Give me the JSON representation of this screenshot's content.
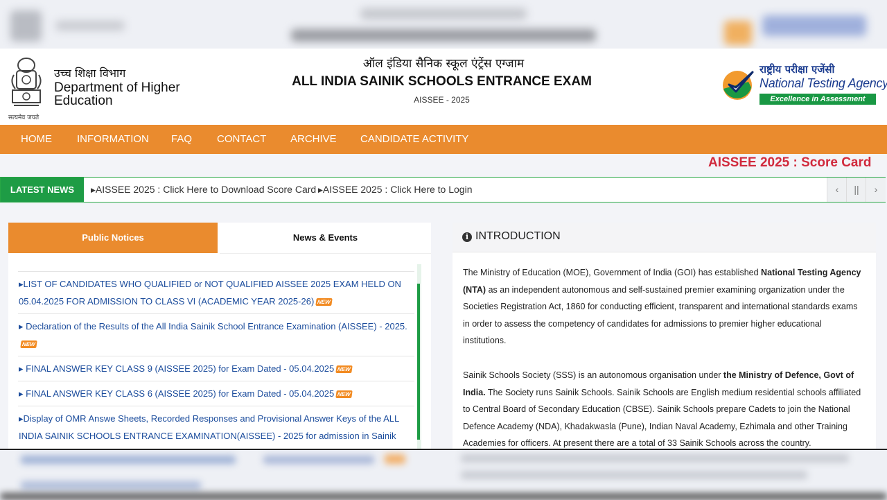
{
  "header": {
    "dept_hindi": "उच्च शिक्षा विभाग",
    "dept_english": "Department of Higher Education",
    "emblem_caption": "सत्यमेव जयते",
    "title_hindi": "ऑल इंडिया सैनिक स्कूल एंट्रेंस एग्जाम",
    "title_english": "ALL INDIA SAINIK SCHOOLS ENTRANCE EXAM",
    "subtitle": "AISSEE - 2025",
    "nta_hindi": "राष्ट्रीय परीक्षा एजेंसी",
    "nta_english": "National Testing Agency",
    "nta_tagline": "Excellence in Assessment"
  },
  "nav": {
    "items": [
      "HOME",
      "INFORMATION",
      "FAQ",
      "CONTACT",
      "ARCHIVE",
      "CANDIDATE ACTIVITY"
    ]
  },
  "marquee": "AISSEE 2025 : Score Card",
  "latest_news": {
    "label": "LATEST NEWS",
    "items": [
      "AISSEE 2025 : Click Here to Download Score Card",
      "AISSEE 2025 : Click Here to Login"
    ],
    "controls": [
      "‹",
      "||",
      "›"
    ]
  },
  "tabs": {
    "public_notices": "Public Notices",
    "news_events": "News & Events"
  },
  "notices": [
    {
      "text": "LIST OF CANDIDATES WHO QUALIFIED or NOT QUALIFIED AISSEE 2025 EXAM HELD ON 05.04.2025 FOR ADMISSION TO CLASS VI (ACADEMIC YEAR 2025-26)",
      "new": "NEW"
    },
    {
      "text": " Declaration of the Results of the All India Sainik School Entrance Examination (AISSEE) - 2025.",
      "new": "NEW"
    },
    {
      "text": " FINAL ANSWER KEY CLASS 9 (AISSEE 2025) for Exam Dated - 05.04.2025",
      "new": "NEW"
    },
    {
      "text": " FINAL ANSWER KEY CLASS 6 (AISSEE 2025) for Exam Dated - 05.04.2025",
      "new": "NEW"
    },
    {
      "text": "Display of OMR Answe Sheets, Recorded Responses and Provisional Answer Keys of the ALL INDIA SAINIK SCHOOLS ENTRANCE EXAMINATION(AISSEE) - 2025 for admission in Sainik Schools",
      "new": "NEW"
    },
    {
      "text": " How to Fill OMR Sheet - Click Here to View Video",
      "new": ""
    }
  ],
  "introduction": {
    "title": "INTRODUCTION",
    "p1_a": "The Ministry of Education (MOE), Government of India (GOI) has established ",
    "p1_b": "National Testing Agency (NTA)",
    "p1_c": " as an independent autonomous and self-sustained premier examining organization under the Societies Registration Act, 1860 for conducting efficient, transparent and international standards exams in order to assess the competency of candidates for admissions to premier higher educational institutions.",
    "p2_a": "Sainik Schools Society (SSS) is an autonomous organisation under ",
    "p2_b": "the Ministry of Defence, Govt of India.",
    "p2_c": " The Society runs Sainik Schools. Sainik Schools are English medium residential schools affiliated to Central Board of Secondary Education (CBSE). Sainik Schools prepare Cadets to join the National Defence Academy (NDA), Khadakwasla (Pune), Indian Naval Academy, Ezhimala and other Training Academies for officers. At present there are a total of 33 Sainik Schools across the country."
  },
  "colors": {
    "nav_orange": "#ea8b2e",
    "latest_green": "#1e9c45",
    "marquee_red": "#d12a3d",
    "link_blue": "#1b4c9c",
    "nta_blue": "#1a3b8f"
  }
}
